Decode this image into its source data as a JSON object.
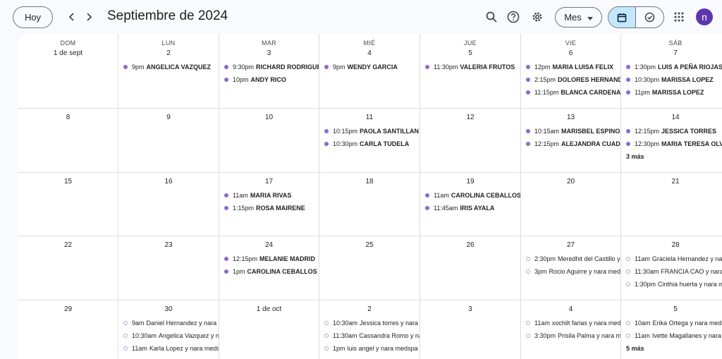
{
  "header": {
    "today_label": "Hoy",
    "title": "Septiembre de 2024",
    "view_label": "Mes",
    "avatar_initial": "n",
    "icons": [
      "chevron-left-icon",
      "chevron-right-icon",
      "search-icon",
      "help-icon",
      "gear-icon",
      "caret-down-icon",
      "calendar-icon",
      "tasks-check-icon",
      "apps-grid-icon"
    ]
  },
  "colors": {
    "event_dot": "#8e67d6",
    "selected_segment": "#c2e7ff",
    "avatar": "#5e35b1"
  },
  "weekdays": [
    "DOM",
    "LUN",
    "MAR",
    "MIÉ",
    "JUE",
    "VIE",
    "SÁB"
  ],
  "weeks": [
    [
      {
        "day": "1 de sept",
        "events": []
      },
      {
        "day": "2",
        "events": [
          {
            "time": "9pm",
            "title": "ANGELICA VAZQUEZ",
            "style": "filled"
          }
        ]
      },
      {
        "day": "3",
        "events": [
          {
            "time": "9:30pm",
            "title": "RICHARD RODRIGUEZ",
            "style": "filled"
          },
          {
            "time": "10pm",
            "title": "ANDY RICO",
            "style": "filled"
          }
        ]
      },
      {
        "day": "4",
        "events": [
          {
            "time": "9pm",
            "title": "WENDY GARCIA",
            "style": "filled"
          }
        ]
      },
      {
        "day": "5",
        "events": [
          {
            "time": "11:30pm",
            "title": "VALERIA FRUTOS",
            "style": "filled"
          }
        ]
      },
      {
        "day": "6",
        "events": [
          {
            "time": "12pm",
            "title": "MARIA LUISA FELIX",
            "style": "filled"
          },
          {
            "time": "2:15pm",
            "title": "DOLORES HERNANDEZ",
            "style": "filled"
          },
          {
            "time": "11:15pm",
            "title": "BLANCA CARDENAS",
            "style": "filled"
          }
        ]
      },
      {
        "day": "7",
        "events": [
          {
            "time": "1:30pm",
            "title": "LUIS A PEÑA RIOJAS",
            "style": "filled"
          },
          {
            "time": "10:30pm",
            "title": "MARISSA LOPEZ",
            "style": "filled"
          },
          {
            "time": "11pm",
            "title": "MARISSA LOPEZ",
            "style": "filled"
          }
        ]
      }
    ],
    [
      {
        "day": "8",
        "events": []
      },
      {
        "day": "9",
        "events": []
      },
      {
        "day": "10",
        "events": []
      },
      {
        "day": "11",
        "events": [
          {
            "time": "10:15pm",
            "title": "PAOLA SANTILLAN",
            "style": "filled"
          },
          {
            "time": "10:30pm",
            "title": "CARLA TUDELA",
            "style": "filled"
          }
        ]
      },
      {
        "day": "12",
        "events": []
      },
      {
        "day": "13",
        "events": [
          {
            "time": "10:15am",
            "title": "MARISBEL ESPINOZA",
            "style": "filled"
          },
          {
            "time": "12:15pm",
            "title": "ALEJANDRA CUADRA",
            "style": "filled"
          }
        ]
      },
      {
        "day": "14",
        "events": [
          {
            "time": "12:15pm",
            "title": "JESSICA TORRES",
            "style": "filled"
          },
          {
            "time": "12:30pm",
            "title": "MARIA TERESA OLVERA",
            "style": "filled"
          }
        ],
        "more": "3 más"
      }
    ],
    [
      {
        "day": "15",
        "events": []
      },
      {
        "day": "16",
        "events": []
      },
      {
        "day": "17",
        "events": [
          {
            "time": "11am",
            "title": "MARIA RIVAS",
            "style": "filled"
          },
          {
            "time": "1:15pm",
            "title": "ROSA MAIRENE",
            "style": "filled"
          }
        ]
      },
      {
        "day": "18",
        "events": []
      },
      {
        "day": "19",
        "events": [
          {
            "time": "11am",
            "title": "CAROLINA CEBALLOS",
            "style": "filled"
          },
          {
            "time": "11:45am",
            "title": "IRIS AYALA",
            "style": "filled"
          }
        ]
      },
      {
        "day": "20",
        "events": []
      },
      {
        "day": "21",
        "events": []
      }
    ],
    [
      {
        "day": "22",
        "events": []
      },
      {
        "day": "23",
        "events": []
      },
      {
        "day": "24",
        "events": [
          {
            "time": "12:15pm",
            "title": "MELANIE MADRID",
            "style": "filled"
          },
          {
            "time": "1pm",
            "title": "CAROLINA CEBALLOS",
            "style": "filled"
          }
        ]
      },
      {
        "day": "25",
        "events": []
      },
      {
        "day": "26",
        "events": []
      },
      {
        "day": "27",
        "events": [
          {
            "time": "2:30pm",
            "title": "Meredhit del Castillo y nara medspa",
            "style": "outline"
          },
          {
            "time": "3pm",
            "title": "Rocio Aguirre y nara medspa",
            "style": "outline"
          }
        ]
      },
      {
        "day": "28",
        "events": [
          {
            "time": "11am",
            "title": "Graciela Hernandez y nara medspa",
            "style": "outline"
          },
          {
            "time": "11:30am",
            "title": "FRANCIA CAO y nara medspa",
            "style": "outline"
          },
          {
            "time": "1:30pm",
            "title": "Cinthia huerta y nara medspa",
            "style": "outline"
          }
        ]
      }
    ],
    [
      {
        "day": "29",
        "events": []
      },
      {
        "day": "30",
        "events": [
          {
            "time": "9am",
            "title": "Daniel Hernandez y nara medspa",
            "style": "outline"
          },
          {
            "time": "10:30am",
            "title": "Angelica Vazquez y nara medspa",
            "style": "outline"
          },
          {
            "time": "11am",
            "title": "Karla Lopez y nara medspa",
            "style": "outline"
          }
        ]
      },
      {
        "day": "1 de oct",
        "events": []
      },
      {
        "day": "2",
        "events": [
          {
            "time": "10:30am",
            "title": "Jessica torres y nara medspa",
            "style": "outline"
          },
          {
            "time": "11:30am",
            "title": "Cassandra Romo y nara medspa",
            "style": "outline"
          },
          {
            "time": "1pm",
            "title": "luis angel y nara medspa",
            "style": "outline"
          }
        ]
      },
      {
        "day": "3",
        "events": []
      },
      {
        "day": "4",
        "events": [
          {
            "time": "11am",
            "title": "xochilt farias y nara medspa",
            "style": "outline"
          },
          {
            "time": "3:30pm",
            "title": "Prisila Palma y nara medspa",
            "style": "outline"
          }
        ]
      },
      {
        "day": "5",
        "events": [
          {
            "time": "10am",
            "title": "Erika Ortega y nara medspa",
            "style": "outline"
          },
          {
            "time": "11am",
            "title": "Ivette Magallanes y nara medspa",
            "style": "outline"
          }
        ],
        "more": "5 más"
      }
    ]
  ]
}
